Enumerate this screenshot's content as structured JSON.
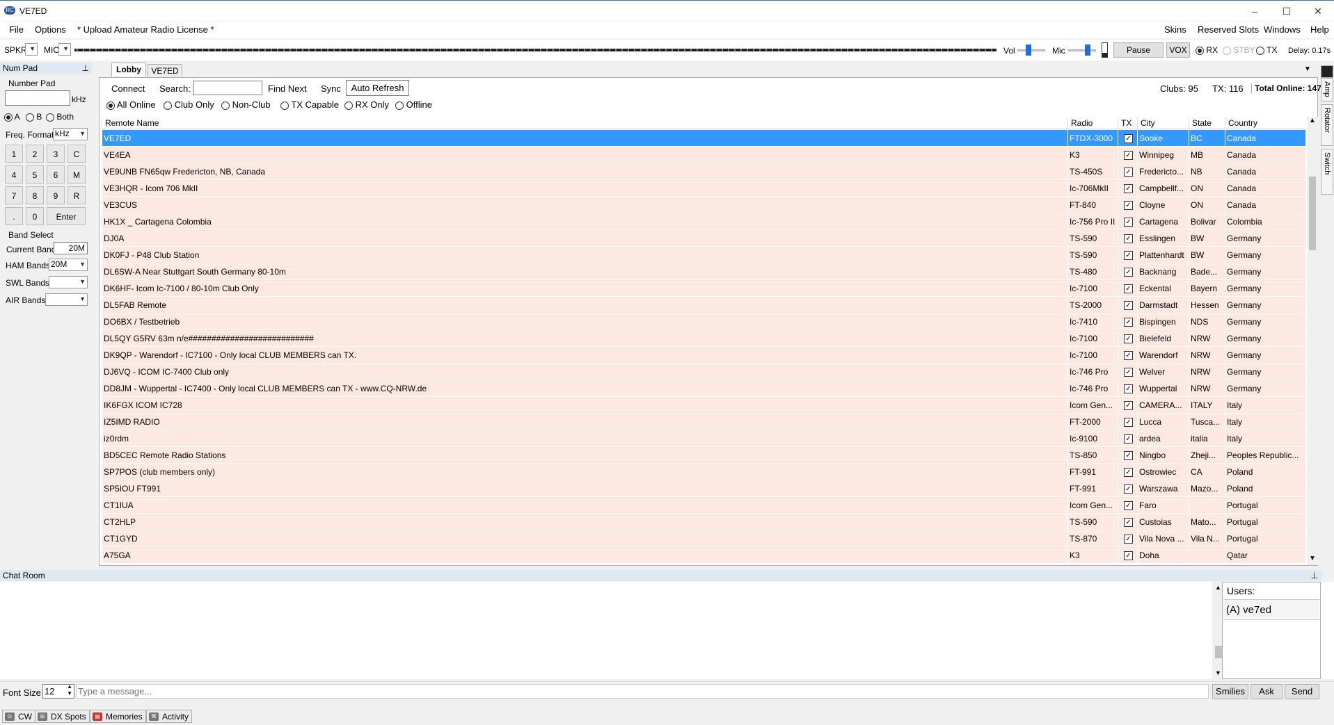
{
  "window": {
    "title": "VE7ED",
    "controls": [
      "–",
      "☐",
      "✕"
    ]
  },
  "menu": {
    "left": [
      "File",
      "Options",
      "* Upload Amateur Radio License *"
    ],
    "right": [
      "Skins",
      "Reserved Slots",
      "Windows",
      "Help"
    ]
  },
  "audio": {
    "spkr_label": "SPKR",
    "mic_label": "MIC",
    "vol_label": "Vol",
    "mic_slider_label": "Mic",
    "pause": "Pause",
    "vox": "VOX",
    "modes": [
      "RX",
      "STBY",
      "TX"
    ],
    "mode_selected": "RX",
    "delay": "Delay: 0.17s"
  },
  "numpad": {
    "header": "Num Pad",
    "group_label": "Number Pad",
    "unit": "kHz",
    "vfo_options": [
      "A",
      "B",
      "Both"
    ],
    "vfo_selected": "A",
    "freq_format_label": "Freq. Format",
    "freq_format_value": "kHz",
    "keys": [
      "1",
      "2",
      "3",
      "C",
      "4",
      "5",
      "6",
      "M",
      "7",
      "8",
      "9",
      "R",
      ".",
      "0",
      "Enter"
    ],
    "band_select_label": "Band Select",
    "current_band_label": "Current Band",
    "current_band_value": "20M",
    "ham_bands_label": "HAM Bands",
    "ham_bands_value": "20M",
    "swl_bands_label": "SWL Bands",
    "air_bands_label": "AIR Bands"
  },
  "tabs": [
    "Lobby",
    "VE7ED"
  ],
  "lobby": {
    "connect": "Connect",
    "search_label": "Search:",
    "find_next": "Find Next",
    "sync": "Sync",
    "auto_refresh": "Auto Refresh",
    "clubs": "Clubs: 95",
    "tx": "TX: 116",
    "total": "Total Online: 147",
    "filters": [
      "All Online",
      "Club Only",
      "Non-Club",
      "TX Capable",
      "RX Only",
      "Offline"
    ],
    "filter_selected": "All Online",
    "columns": [
      "Remote Name",
      "Radio",
      "TX",
      "City",
      "State",
      "Country"
    ],
    "rows": [
      [
        "VE7ED",
        "FTDX-3000",
        "✓",
        "Sooke",
        "BC",
        "Canada"
      ],
      [
        "VE4EA",
        "K3",
        "✓",
        "Winnipeg",
        "MB",
        "Canada"
      ],
      [
        "VE9UNB FN65qw Fredericton, NB, Canada",
        "TS-450S",
        "✓",
        "Fredericto...",
        "NB",
        "Canada"
      ],
      [
        "VE3HQR - Icom 706 MkII",
        "Ic-706MkII",
        "✓",
        "Campbellf...",
        "ON",
        "Canada"
      ],
      [
        "VE3CUS",
        "FT-840",
        "✓",
        "Cloyne",
        "ON",
        "Canada"
      ],
      [
        "HK1X _ Cartagena Colombia",
        "Ic-756 Pro II",
        "✓",
        "Cartagena",
        "Bolivar",
        "Colombia"
      ],
      [
        "DJ0A",
        "TS-590",
        "✓",
        "Esslingen",
        "BW",
        "Germany"
      ],
      [
        "DK0FJ - P48 Club Station",
        "TS-590",
        "✓",
        "Plattenhardt",
        "BW",
        "Germany"
      ],
      [
        "DL6SW-A Near Stuttgart South Germany 80-10m",
        "TS-480",
        "✓",
        "Backnang",
        "Bade...",
        "Germany"
      ],
      [
        "DK6HF- Icom Ic-7100 / 80-10m Club Only",
        "Ic-7100",
        "✓",
        "Eckental",
        "Bayern",
        "Germany"
      ],
      [
        "DL5FAB Remote",
        "TS-2000",
        "✓",
        "Darmstadt",
        "Hessen",
        "Germany"
      ],
      [
        "DO6BX / Testbetrieb",
        "Ic-7410",
        "✓",
        "Bispingen",
        "NDS",
        "Germany"
      ],
      [
        "DL5QY G5RV 63m n/e###########################",
        "Ic-7100",
        "✓",
        "Bielefeld",
        "NRW",
        "Germany"
      ],
      [
        "DK9QP - Warendorf - IC7100 - Only local CLUB MEMBERS can TX.",
        "Ic-7100",
        "✓",
        "Warendorf",
        "NRW",
        "Germany"
      ],
      [
        "DJ6VQ - ICOM IC-7400  Club only",
        "Ic-746 Pro",
        "✓",
        "Welver",
        "NRW",
        "Germany"
      ],
      [
        "DD8JM - Wuppertal - IC7400 - Only local CLUB MEMBERS can TX - www.CQ-NRW.de",
        "Ic-746 Pro",
        "✓",
        "Wuppertal",
        "NRW",
        "Germany"
      ],
      [
        "IK6FGX ICOM IC728",
        "Icom Gen...",
        "✓",
        "CAMERA...",
        "ITALY",
        "Italy"
      ],
      [
        "IZ5IMD RADIO",
        "FT-2000",
        "✓",
        "Lucca",
        "Tusca...",
        "Italy"
      ],
      [
        "iz0rdm",
        "Ic-9100",
        "✓",
        "ardea",
        "italia",
        "Italy"
      ],
      [
        "BD5CEC Remote Radio Stations",
        "TS-850",
        "✓",
        "Ningbo",
        "Zheji...",
        "Peoples Republic..."
      ],
      [
        "SP7POS (club members only)",
        "FT-991",
        "✓",
        "Ostrowiec",
        "CA",
        "Poland"
      ],
      [
        "SP5IOU FT991",
        "FT-991",
        "✓",
        "Warszawa",
        "Mazo...",
        "Poland"
      ],
      [
        "CT1IUA",
        "Icom Gen...",
        "✓",
        "Faro",
        "",
        "Portugal"
      ],
      [
        "CT2HLP",
        "TS-590",
        "✓",
        "Custoias",
        "Mato...",
        "Portugal"
      ],
      [
        "CT1GYD",
        "TS-870",
        "✓",
        "Vila Nova ...",
        "Vila N...",
        "Portugal"
      ],
      [
        "A75GA",
        "K3",
        "✓",
        "Doha",
        "",
        "Qatar"
      ]
    ]
  },
  "side_tabs": [
    "Amp",
    "Rotator",
    "Switch"
  ],
  "chat": {
    "header": "Chat Room",
    "users_label": "Users:",
    "users": [
      "(A) ve7ed"
    ],
    "font_size_label": "Font Size",
    "font_size_value": "12",
    "placeholder": "Type a message...",
    "buttons": [
      "Smilies",
      "Ask",
      "Send"
    ]
  },
  "bottom_tabs": [
    "CW",
    "DX Spots",
    "Memories",
    "Activity"
  ]
}
